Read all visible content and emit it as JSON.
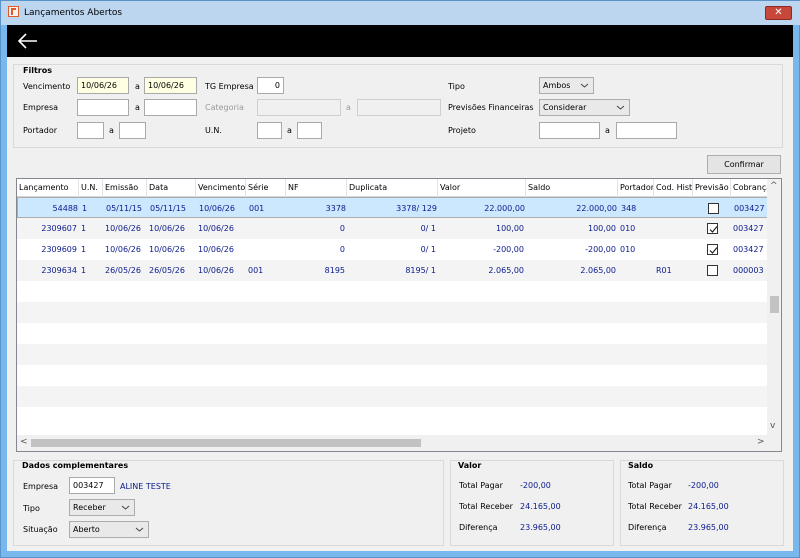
{
  "window": {
    "title": "Lançamentos Abertos",
    "close_label": "✕"
  },
  "filters": {
    "legend": "Filtros",
    "vencimento_label": "Vencimento",
    "vencimento_from": "10/06/26",
    "a1": "a",
    "vencimento_to": "10/06/26",
    "tg_empresa_label": "TG Empresa",
    "tg_empresa_value": "0",
    "tipo_label": "Tipo",
    "tipo_value": "Ambos",
    "empresa_label": "Empresa",
    "a2": "a",
    "categoria_label": "Categoria",
    "a3": "a",
    "previsoes_label": "Previsões Financeiras",
    "previsoes_value": "Considerar",
    "portador_label": "Portador",
    "a4": "a",
    "un_label": "U.N.",
    "a5": "a",
    "projeto_label": "Projeto",
    "a6": "a"
  },
  "confirm_label": "Confirmar",
  "grid": {
    "headers": [
      "Lançamento",
      "U.N.",
      "Emissão",
      "Data",
      "Vencimento",
      "Série",
      "NF",
      "Duplicata",
      "Valor",
      "Saldo",
      "Portador",
      "Cod. Hist",
      "Previsão",
      "Cobrança"
    ],
    "rows": [
      {
        "lancamento": "54488",
        "un": "1",
        "emissao": "05/11/15",
        "data": "05/11/15",
        "vencimento": "10/06/26",
        "serie": "001",
        "nf": "3378",
        "duplicata": "3378/ 129",
        "valor": "22.000,00",
        "saldo": "22.000,00",
        "portador": "348",
        "codhist": "",
        "previsao": false,
        "cobranca": "003427"
      },
      {
        "lancamento": "2309607",
        "un": "1",
        "emissao": "10/06/26",
        "data": "10/06/26",
        "vencimento": "10/06/26",
        "serie": "",
        "nf": "0",
        "duplicata": "0/ 1",
        "valor": "100,00",
        "saldo": "100,00",
        "portador": "010",
        "codhist": "",
        "previsao": true,
        "cobranca": "003427"
      },
      {
        "lancamento": "2309609",
        "un": "1",
        "emissao": "10/06/26",
        "data": "10/06/26",
        "vencimento": "10/06/26",
        "serie": "",
        "nf": "0",
        "duplicata": "0/ 1",
        "valor": "-200,00",
        "saldo": "-200,00",
        "portador": "010",
        "codhist": "",
        "previsao": true,
        "cobranca": "003427"
      },
      {
        "lancamento": "2309634",
        "un": "1",
        "emissao": "26/05/26",
        "data": "26/05/26",
        "vencimento": "10/06/26",
        "serie": "001",
        "nf": "8195",
        "duplicata": "8195/ 1",
        "valor": "2.065,00",
        "saldo": "2.065,00",
        "portador": "",
        "codhist": "R01",
        "previsao": false,
        "cobranca": "000003"
      }
    ]
  },
  "complementares": {
    "legend": "Dados complementares",
    "empresa_label": "Empresa",
    "empresa_code": "003427",
    "empresa_name": "ALINE TESTE",
    "tipo_label": "Tipo",
    "tipo_value": "Receber",
    "situacao_label": "Situação",
    "situacao_value": "Aberto"
  },
  "valor": {
    "legend": "Valor",
    "total_pagar_label": "Total Pagar",
    "total_pagar": "-200,00",
    "total_receber_label": "Total Receber",
    "total_receber": "24.165,00",
    "diferenca_label": "Diferença",
    "diferenca": "23.965,00"
  },
  "saldo": {
    "legend": "Saldo",
    "total_pagar_label": "Total Pagar",
    "total_pagar": "-200,00",
    "total_receber_label": "Total Receber",
    "total_receber": "24.165,00",
    "diferenca_label": "Diferença",
    "diferenca": "23.965,00"
  }
}
